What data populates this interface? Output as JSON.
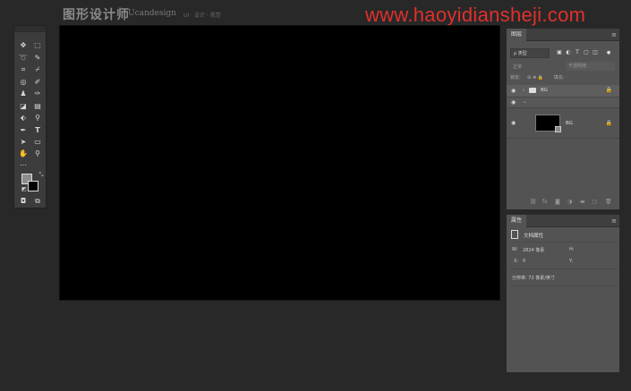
{
  "header": {
    "brand": "图形设计师",
    "brand_en": "Ucandesign",
    "tags": "UI · 设计 · 视觉"
  },
  "watermark": "www.haoyidiansheji.com",
  "toolbar": {
    "icons": [
      "move-tool",
      "marquee-tool",
      "lasso-tool",
      "quick-select-tool",
      "crop-tool",
      "eyedropper-tool",
      "patch-tool",
      "brush-tool",
      "stamp-tool",
      "history-brush-tool",
      "eraser-tool",
      "gradient-tool",
      "blur-tool",
      "dodge-tool",
      "pen-tool",
      "type-tool",
      "path-select-tool",
      "shape-tool",
      "hand-tool",
      "zoom-tool",
      "more-tools",
      "color-swatches",
      "quick-mask",
      "screen-mode"
    ],
    "type_glyph": "T"
  },
  "layers_panel": {
    "title": "图层",
    "filter_placeholder": "ρ 类型",
    "blend_mode": "正常",
    "opacity_label": "不透明度:",
    "lock_label": "锁定:",
    "fill_label": "填充:",
    "layers": [
      {
        "name": "BG",
        "type": "group"
      },
      {
        "name": "BG",
        "type": "layer"
      }
    ]
  },
  "properties_panel": {
    "title": "属性",
    "doc_label": "文档属性",
    "w_label": "W:",
    "w_value": "2824 像素",
    "h_label": "H:",
    "x_label": "X:",
    "x_value": "0",
    "y_label": "Y:",
    "resolution": "分辨率: 72 像素/英寸"
  },
  "colors": {
    "accent": "#e0302c",
    "canvas": "#000000",
    "panel": "#535353",
    "app_bg": "#282828"
  }
}
